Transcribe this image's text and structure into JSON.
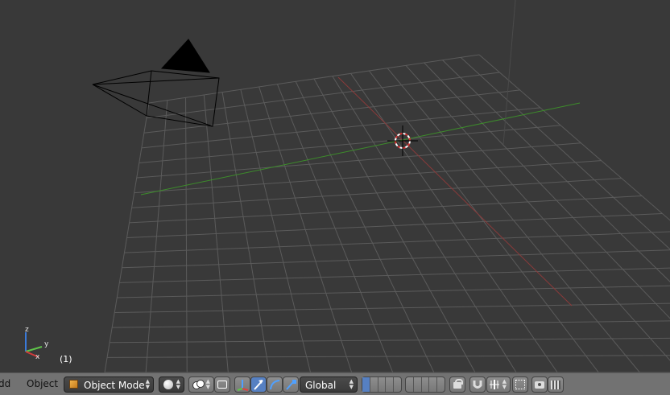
{
  "viewport": {
    "frame_label": "(1)",
    "axis_labels": {
      "x": "x",
      "y": "y",
      "z": "z"
    },
    "colors": {
      "background": "#393939",
      "grid": "#5b5b5b",
      "x_axis": "#8a3a3a",
      "y_axis": "#3d8c2b"
    }
  },
  "header": {
    "menu_add": "Add",
    "menu_object": "Object",
    "mode_dropdown": "Object Mode",
    "orientation_dropdown": "Global",
    "icons": [
      "cube-icon",
      "sphere-shading-icon",
      "pivot-icon",
      "manipulator-icon",
      "translate-icon",
      "rotate-icon",
      "scale-icon",
      "layers-icon",
      "lock-icon",
      "snap-magnet-icon",
      "snap-element-icon",
      "render-icon",
      "render-anim-icon"
    ]
  }
}
